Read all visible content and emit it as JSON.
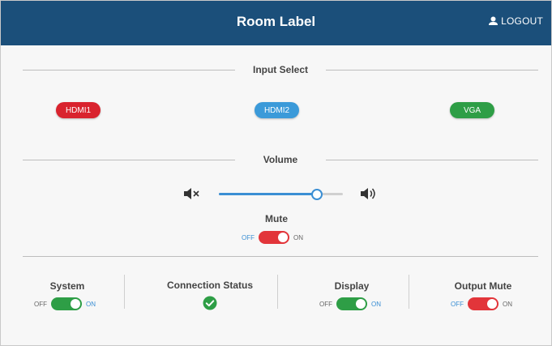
{
  "header": {
    "title": "Room Label",
    "logout_label": "LOGOUT"
  },
  "input_select": {
    "title": "Input Select",
    "buttons": [
      {
        "label": "HDMI1",
        "color": "#d9232e"
      },
      {
        "label": "HDMI2",
        "color": "#3b9ad9"
      },
      {
        "label": "VGA",
        "color": "#2e9e46"
      }
    ]
  },
  "volume": {
    "title": "Volume",
    "level": 0.79
  },
  "mute": {
    "label": "Mute",
    "off_label": "OFF",
    "on_label": "ON",
    "state": "on",
    "color": "#e2353a"
  },
  "status": {
    "system": {
      "label": "System",
      "off_label": "OFF",
      "on_label": "ON",
      "state": "on",
      "color": "#2e9e46"
    },
    "connection": {
      "label": "Connection Status",
      "state": "connected",
      "color": "#2e9e46"
    },
    "display": {
      "label": "Display",
      "off_label": "OFF",
      "on_label": "ON",
      "state": "on",
      "color": "#2e9e46"
    },
    "output_mute": {
      "label": "Output Mute",
      "off_label": "OFF",
      "on_label": "ON",
      "state": "on",
      "color": "#e2353a"
    }
  },
  "colors": {
    "header": "#1b4f7a",
    "slider": "#3b8fd4"
  }
}
